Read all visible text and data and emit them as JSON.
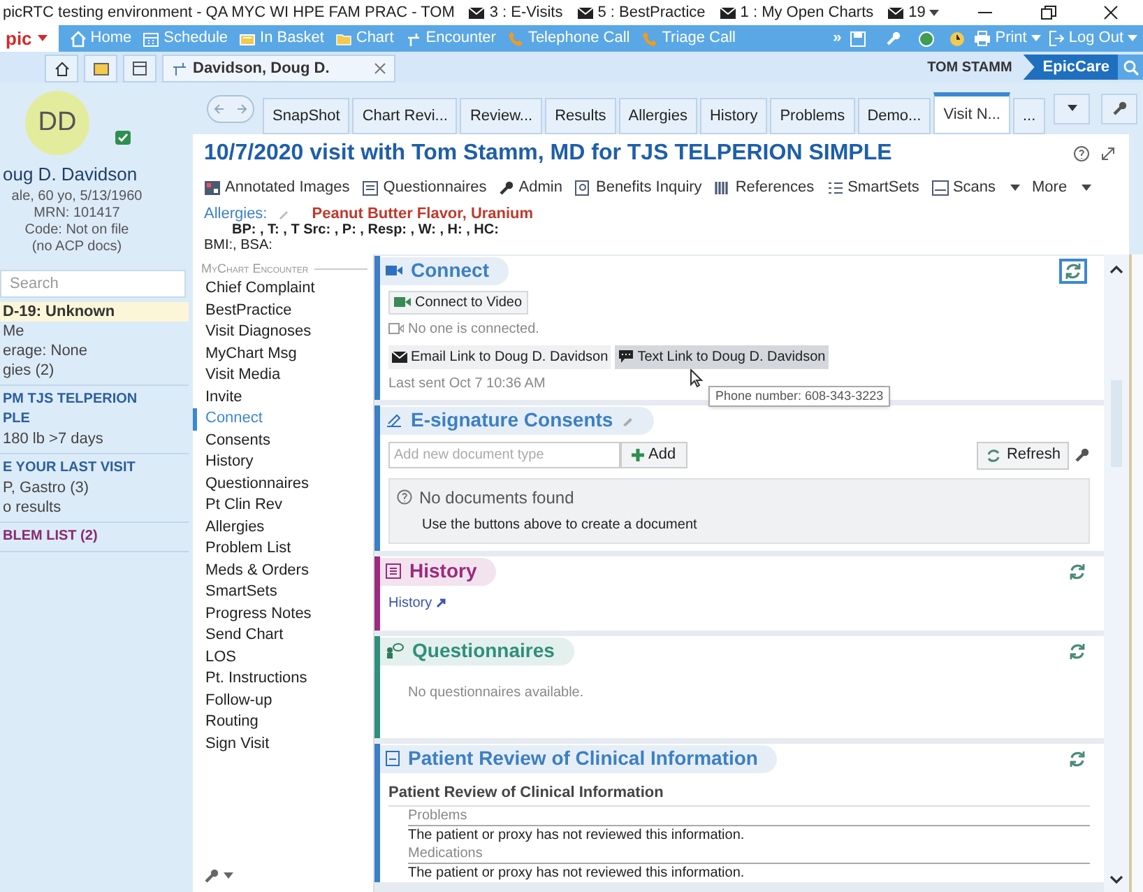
{
  "window": {
    "title": "picRTC testing environment - QA MYC WI HPE FAM PRAC - TOM",
    "messages": [
      {
        "label": "3 : E-Visits"
      },
      {
        "label": "5 : BestPractice"
      },
      {
        "label": "1 : My Open Charts"
      },
      {
        "label": "19"
      }
    ]
  },
  "epic_menu": {
    "label": "pic"
  },
  "toolbar": {
    "items": [
      {
        "label": "Home",
        "kind": "home"
      },
      {
        "label": "Schedule",
        "kind": "calendar"
      },
      {
        "label": "In Basket",
        "kind": "tray"
      },
      {
        "label": "Chart",
        "kind": "folder"
      },
      {
        "label": "Encounter",
        "kind": "pin"
      },
      {
        "label": "Telephone Call",
        "kind": "phone"
      },
      {
        "label": "Triage Call",
        "kind": "phone"
      }
    ],
    "overflow": "»",
    "print": "Print",
    "logout": "Log Out"
  },
  "workspace": {
    "patient_tab": "Davidson, Doug D.",
    "user": "TOM STAMM",
    "app": "EpicCare"
  },
  "patient": {
    "initials": "DD",
    "name": "oug D. Davidson",
    "details": [
      "ale, 60 yo, 5/13/1960",
      "MRN: 101417",
      "Code: Not on file",
      "(no ACP docs)"
    ],
    "search_placeholder": "Search",
    "groups": [
      {
        "items": [
          {
            "text": "D-19: Unknown",
            "kind": "alert"
          },
          {
            "text": "Me",
            "kind": "plain"
          },
          {
            "text": "erage: None",
            "kind": "plain"
          },
          {
            "text": "gies (2)",
            "kind": "plain"
          }
        ]
      },
      {
        "items": [
          {
            "text": "PM TJS TELPERION",
            "kind": "heading"
          },
          {
            "text": "PLE",
            "kind": "heading"
          },
          {
            "text": "180 lb >7 days",
            "kind": "plain"
          }
        ]
      },
      {
        "items": [
          {
            "text": "E YOUR LAST VISIT",
            "kind": "heading"
          },
          {
            "text": "P, Gastro (3)",
            "kind": "plain"
          },
          {
            "text": "o results",
            "kind": "plain"
          }
        ]
      },
      {
        "items": [
          {
            "text": "BLEM LIST (2)",
            "kind": "problem"
          }
        ]
      }
    ]
  },
  "activity_tabs": [
    {
      "label": "SnapShot",
      "selected": false
    },
    {
      "label": "Chart Revi...",
      "selected": false
    },
    {
      "label": "Review...",
      "selected": false
    },
    {
      "label": "Results",
      "selected": false
    },
    {
      "label": "Allergies",
      "selected": false
    },
    {
      "label": "History",
      "selected": false
    },
    {
      "label": "Problems",
      "selected": false
    },
    {
      "label": "Demo...",
      "selected": false
    },
    {
      "label": "Visit N...",
      "selected": true
    },
    {
      "label": "...",
      "selected": false
    }
  ],
  "visit": {
    "title": "10/7/2020 visit with Tom Stamm, MD for TJS TELPERION SIMPLE",
    "toolbar": [
      {
        "label": "Annotated Images",
        "dropdown": false
      },
      {
        "label": "Questionnaires",
        "dropdown": false
      },
      {
        "label": "Admin",
        "dropdown": false
      },
      {
        "label": "Benefits Inquiry",
        "dropdown": false
      },
      {
        "label": "References",
        "dropdown": false
      },
      {
        "label": "SmartSets",
        "dropdown": false
      },
      {
        "label": "Scans",
        "dropdown": true
      },
      {
        "label": "More",
        "dropdown": true
      }
    ],
    "allergies_label": "Allergies:",
    "allergies": "Peanut Butter Flavor, Uranium",
    "vitals": "BP: , T: , T Src: , P: , Resp: , W: , H: , HC:",
    "vitals_2": "BMI:, BSA:"
  },
  "nav": {
    "heading": "MyChart Encounter",
    "items": [
      {
        "label": "Chief Complaint",
        "selected": false
      },
      {
        "label": "BestPractice",
        "selected": false
      },
      {
        "label": "Visit Diagnoses",
        "selected": false
      },
      {
        "label": "MyChart Msg",
        "selected": false
      },
      {
        "label": "Visit Media",
        "selected": false
      },
      {
        "label": "Invite",
        "selected": false
      },
      {
        "label": "Connect",
        "selected": true
      },
      {
        "label": "Consents",
        "selected": false
      },
      {
        "label": "History",
        "selected": false
      },
      {
        "label": "Questionnaires",
        "selected": false
      },
      {
        "label": "Pt Clin Rev",
        "selected": false
      },
      {
        "label": "Allergies",
        "selected": false
      },
      {
        "label": "Problem List",
        "selected": false
      },
      {
        "label": "Meds & Orders",
        "selected": false
      },
      {
        "label": "SmartSets",
        "selected": false
      },
      {
        "label": "Progress Notes",
        "selected": false
      },
      {
        "label": "Send Chart",
        "selected": false
      },
      {
        "label": "LOS",
        "selected": false
      },
      {
        "label": "Pt. Instructions",
        "selected": false
      },
      {
        "label": "Follow-up",
        "selected": false
      },
      {
        "label": "Routing",
        "selected": false
      },
      {
        "label": "Sign Visit",
        "selected": false
      }
    ]
  },
  "sections": [
    {
      "kind": "connect",
      "title": "Connect",
      "color": "#3c7fc4",
      "video_button": "Connect to Video",
      "status": "No one is connected.",
      "link_buttons": [
        {
          "label": "Email Link to Doug D. Davidson",
          "hovered": false
        },
        {
          "label": "Text Link to Doug D. Davidson",
          "hovered": true
        }
      ],
      "last_sent": "Last sent Oct 7 10:36 AM",
      "tooltip": "Phone number: 608-343-3223"
    },
    {
      "kind": "esignature",
      "title": "E-signature Consents",
      "color": "#3c7fc4",
      "input_placeholder": "Add new document type",
      "add_button": "Add",
      "refresh_button": "Refresh",
      "empty_title": "No documents found",
      "empty_text": "Use the buttons above to create a document"
    },
    {
      "kind": "link",
      "title": "History",
      "color": "#9c2a7e",
      "link": "History"
    },
    {
      "kind": "message",
      "title": "Questionnaires",
      "color": "#2f8f7a",
      "message": "No questionnaires available."
    },
    {
      "kind": "review",
      "title": "Patient Review of Clinical Information",
      "color": "#3c7fc4",
      "heading": "Patient Review of Clinical Information",
      "groups": [
        {
          "label": "Problems",
          "text": "The patient or proxy has not reviewed this information."
        },
        {
          "label": "Medications",
          "text": "The patient or proxy has not reviewed this information."
        }
      ]
    }
  ]
}
